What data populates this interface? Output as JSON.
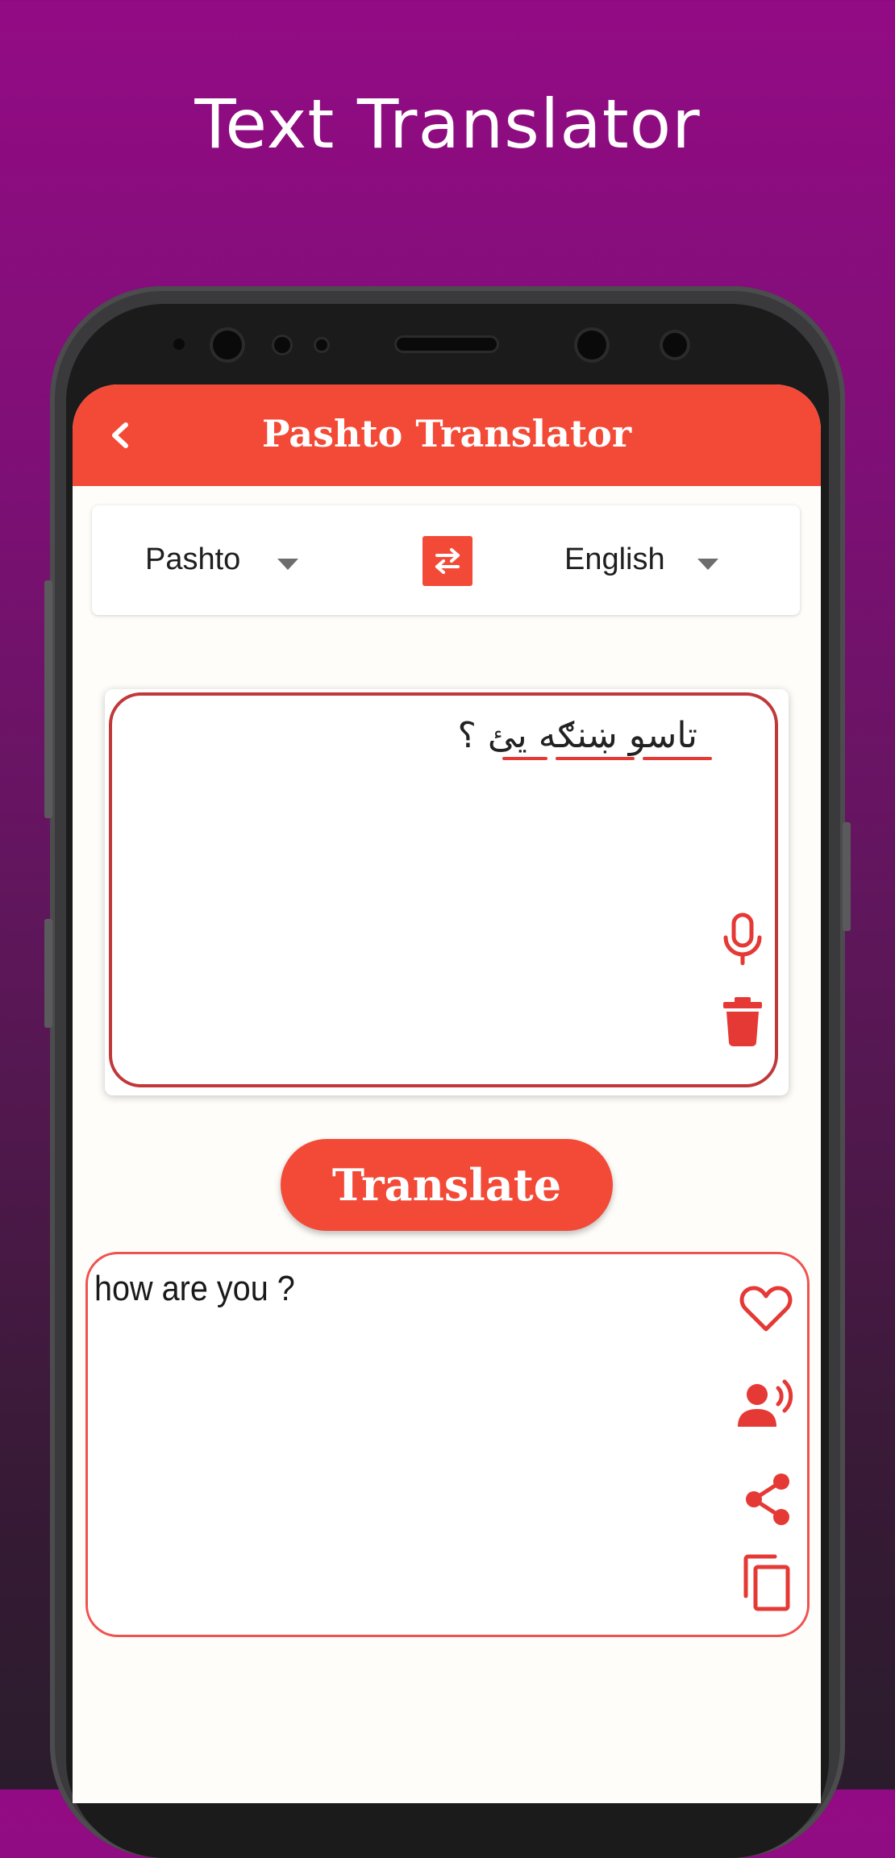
{
  "promo": {
    "title": "Text Translator"
  },
  "app_bar": {
    "title": "Pashto Translator",
    "back_icon": "chevron-left-icon"
  },
  "languages": {
    "source": "Pashto",
    "target": "English",
    "swap_icon": "swap-arrows-icon"
  },
  "input": {
    "text": "تاسو ښنګه یئ ؟",
    "mic_icon": "microphone-icon",
    "delete_icon": "trash-icon"
  },
  "translate_button": {
    "label": "Translate"
  },
  "output": {
    "text": "how are you ?",
    "favorite_icon": "heart-icon",
    "speak_icon": "speaker-person-icon",
    "share_icon": "share-icon",
    "copy_icon": "copy-icon"
  },
  "colors": {
    "accent": "#f34a37",
    "input_border": "#c0383a",
    "output_border": "#ef5350",
    "background_top": "#930b84"
  }
}
